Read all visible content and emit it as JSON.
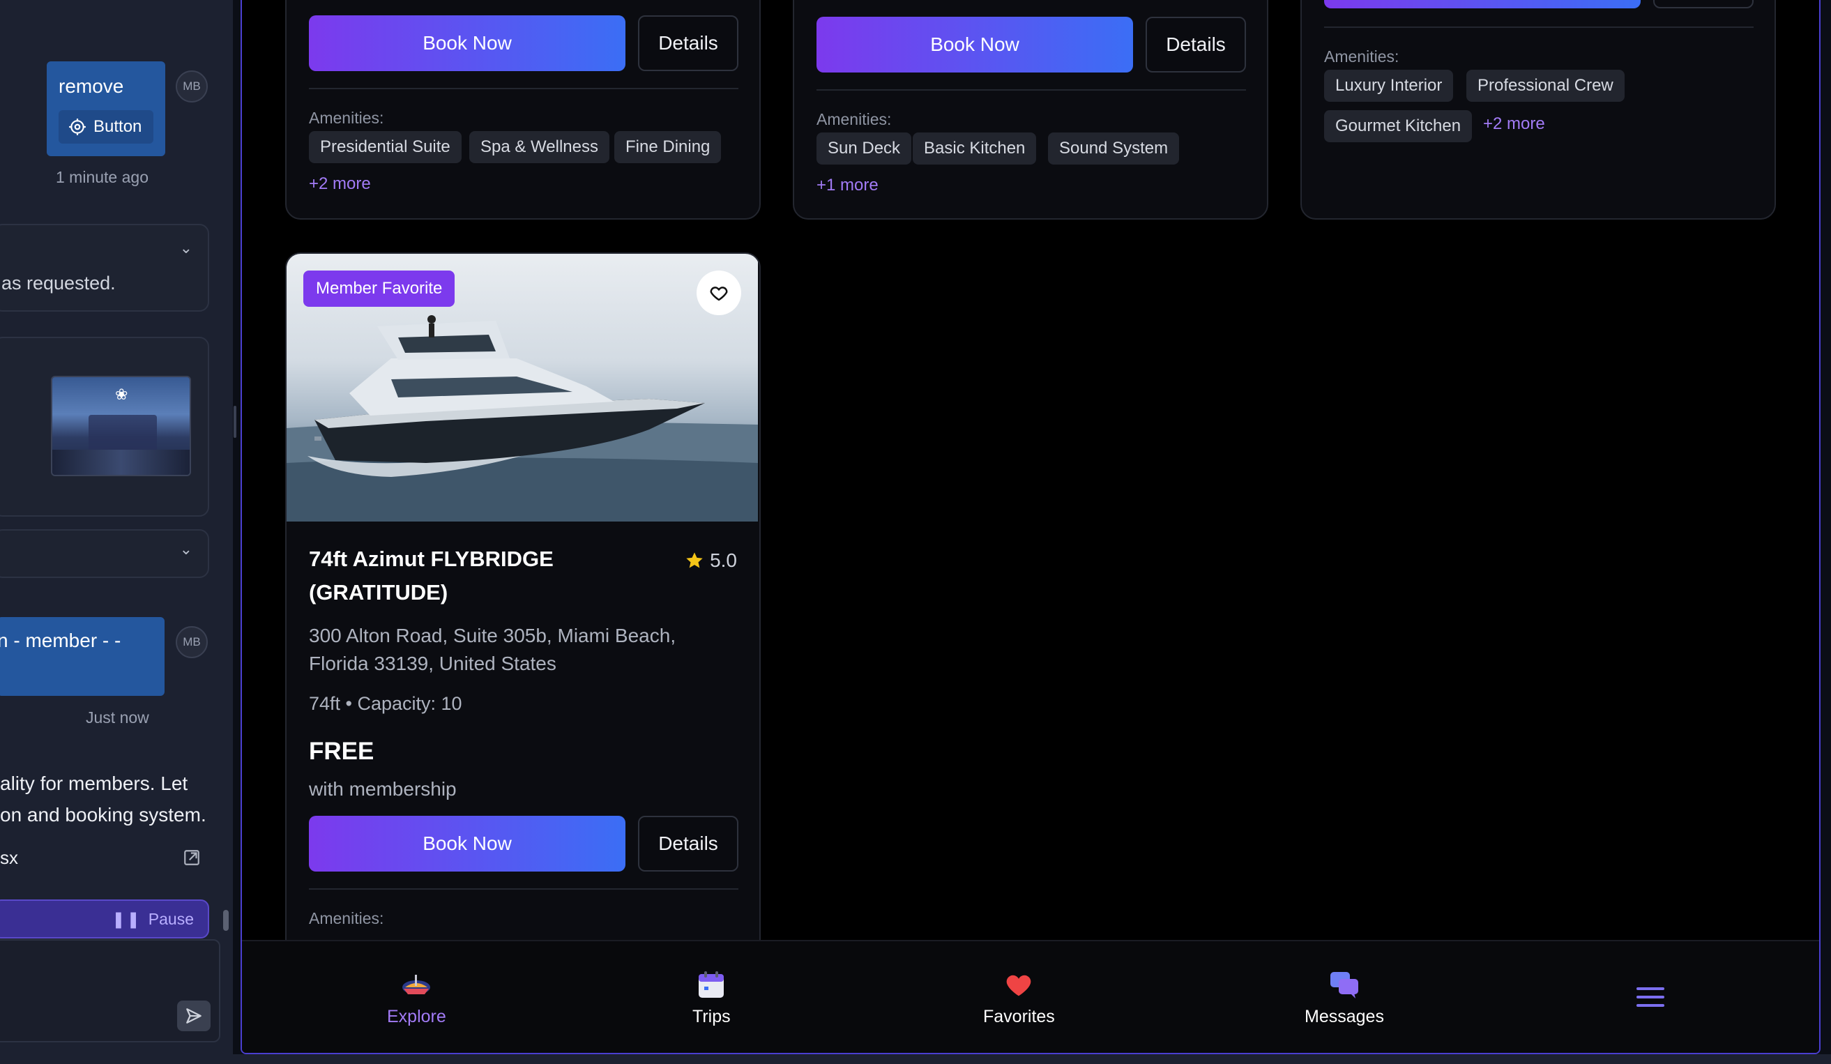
{
  "chat": {
    "bubble1_text": "remove",
    "bubble1_button": "Button",
    "avatar_initials": "MB",
    "ts1": "1 minute ago",
    "collapsed1_text": "as requested.",
    "bubble2_text": "n - member - -",
    "ts2": "Just now",
    "line1": "ality for members. Let",
    "line2": "on and booking system.",
    "line3": "sx",
    "pause_label": "Pause"
  },
  "cards_top": [
    {
      "book": "Book Now",
      "details": "Details",
      "amenities_label": "Amenities:",
      "chips": [
        "Presidential Suite",
        "Spa & Wellness",
        "Fine Dining"
      ],
      "more": "+2 more"
    },
    {
      "book": "Book Now",
      "details": "Details",
      "amenities_label": "Amenities:",
      "chips": [
        "Sun Deck",
        "Basic Kitchen",
        "Sound System"
      ],
      "more": "+1 more"
    },
    {
      "amenities_label": "Amenities:",
      "chips": [
        "Luxury Interior",
        "Professional Crew",
        "Gourmet Kitchen"
      ],
      "more": "+2 more"
    }
  ],
  "featured": {
    "badge": "Member Favorite",
    "title": "74ft Azimut FLYBRIDGE (GRATITUDE)",
    "rating": "5.0",
    "address": "300 Alton Road, Suite 305b, Miami Beach, Florida 33139, United States",
    "specs": "74ft • Capacity: 10",
    "price": "FREE",
    "price_note": "with membership",
    "book": "Book Now",
    "details": "Details",
    "amenities_label": "Amenities:"
  },
  "nav": {
    "explore": "Explore",
    "trips": "Trips",
    "favorites": "Favorites",
    "messages": "Messages"
  },
  "colors": {
    "accent": "#a27bf6",
    "gradient_start": "#7c3aed",
    "gradient_end": "#3b6ef5",
    "star": "#f5c518",
    "heart": "#ef4444"
  }
}
